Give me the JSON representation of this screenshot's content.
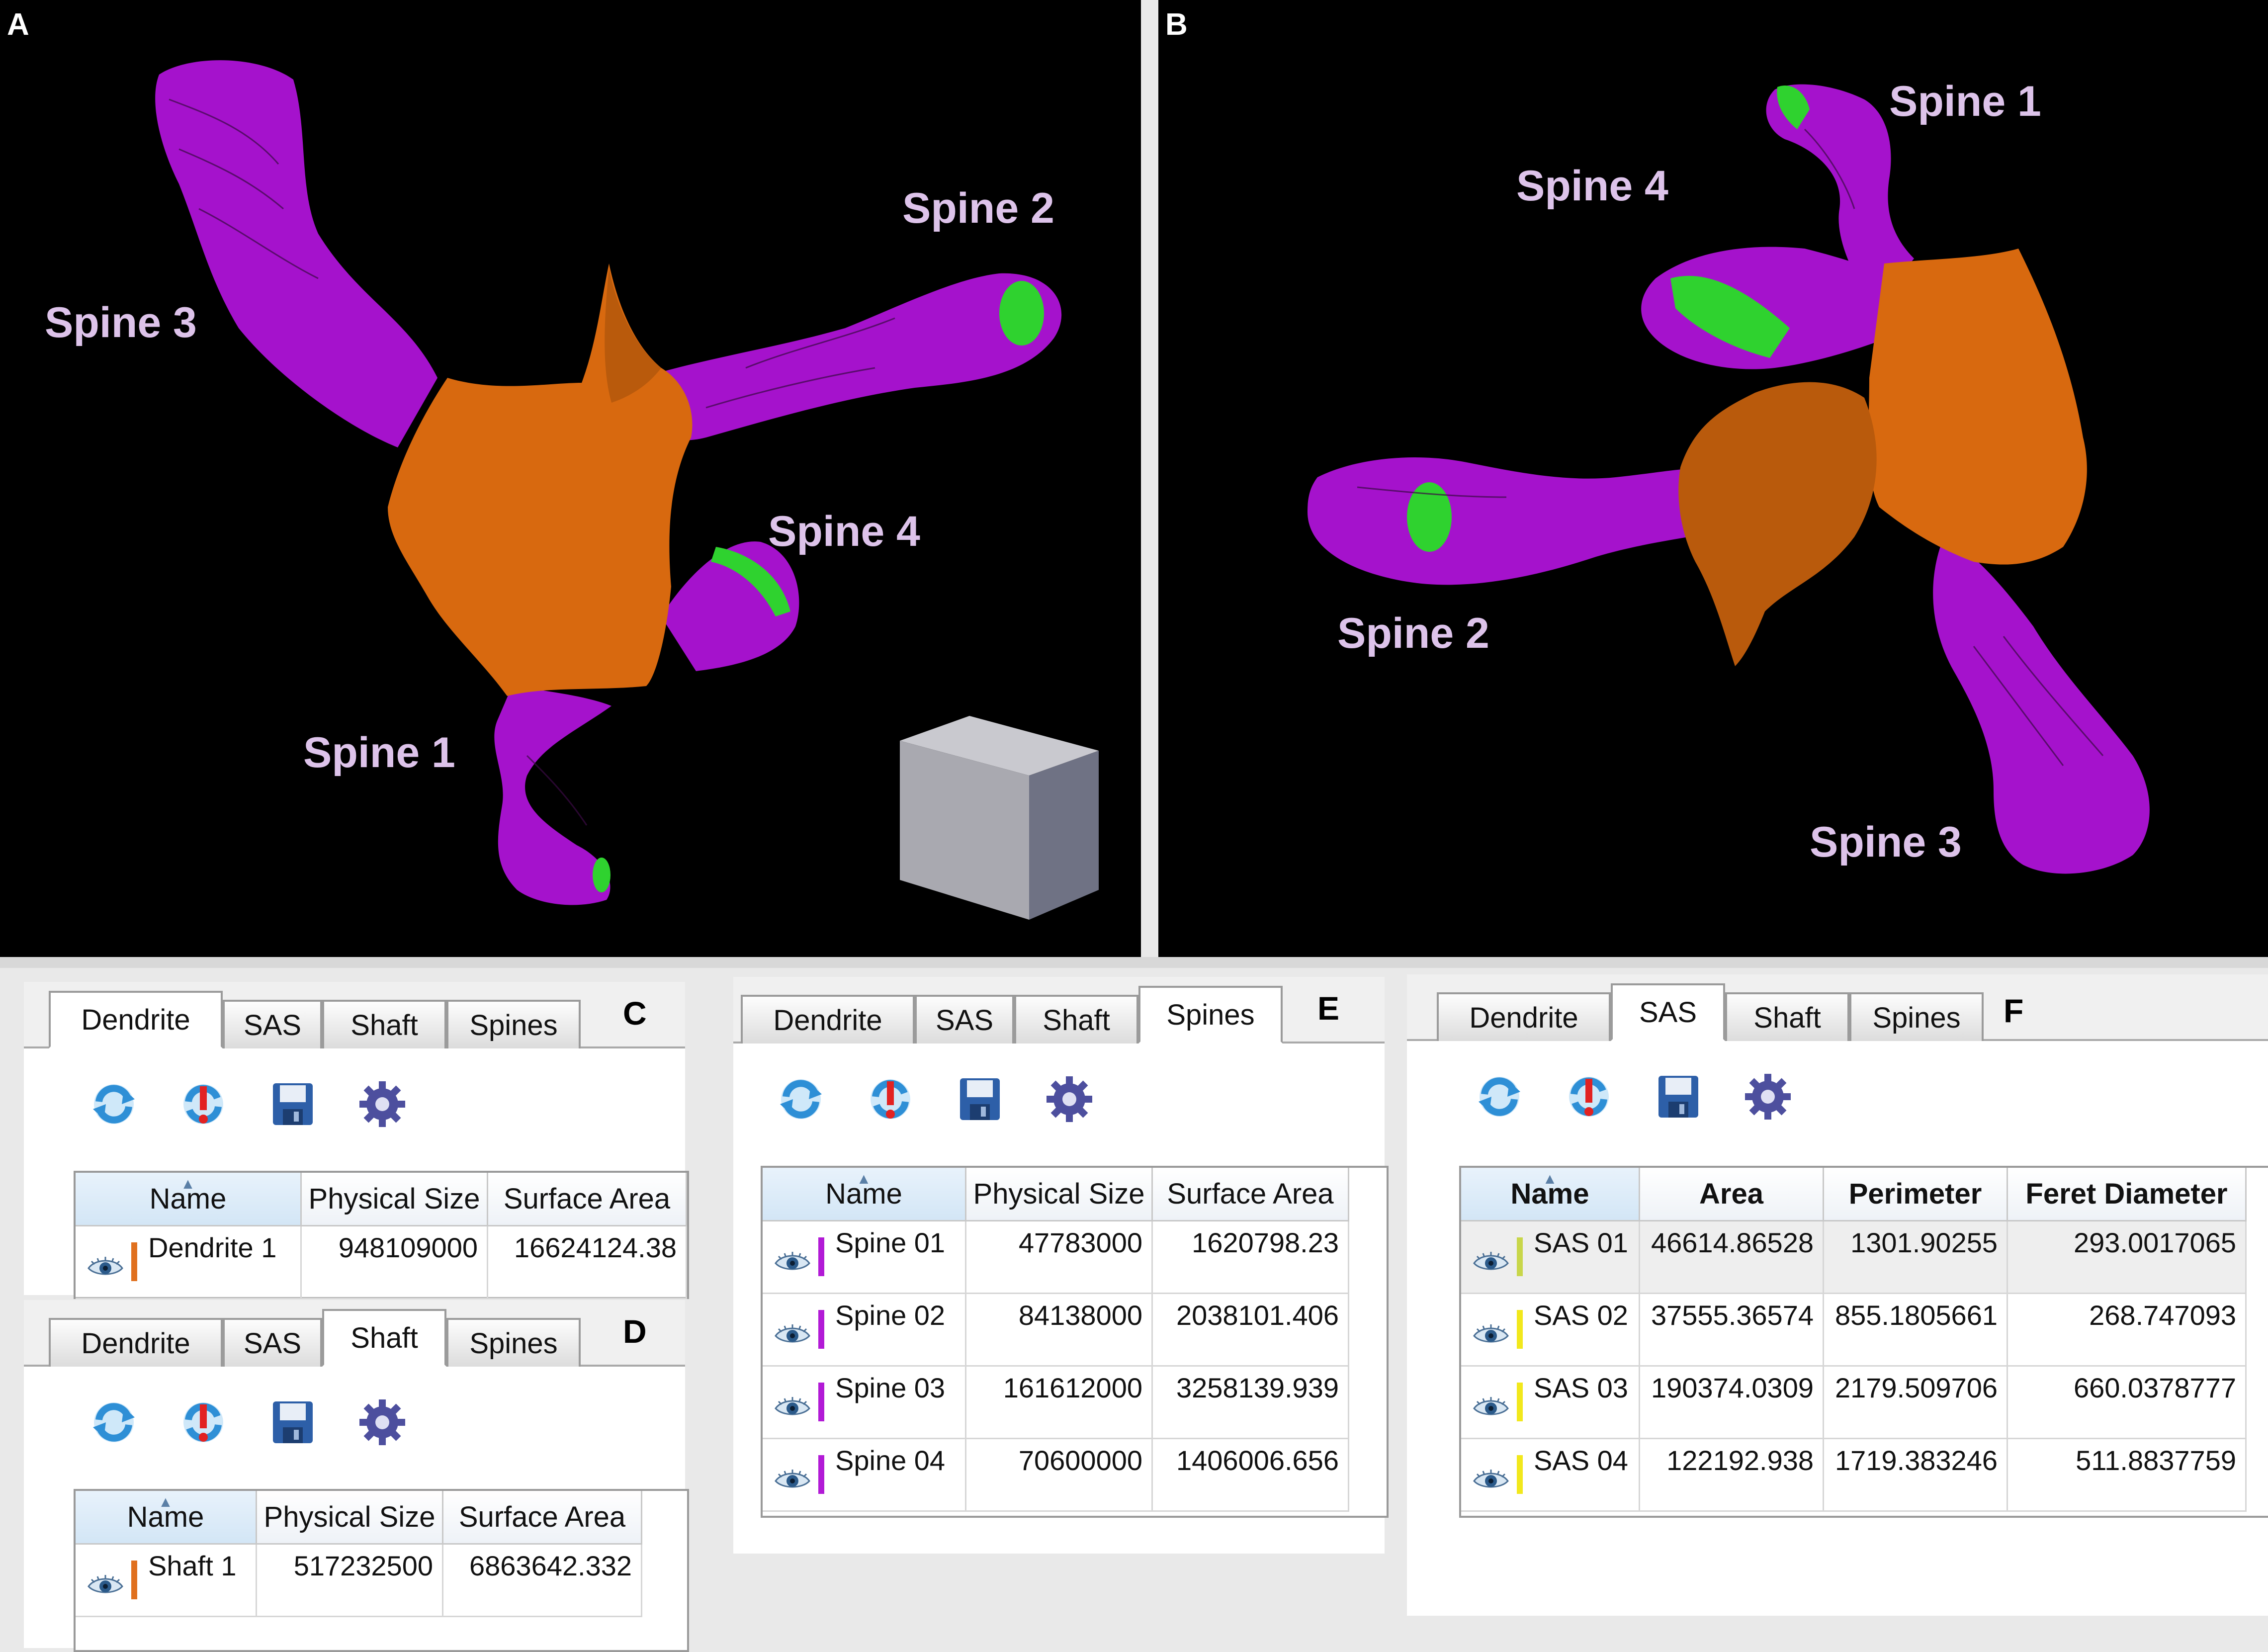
{
  "views": {
    "a": {
      "letter": "A",
      "labels": {
        "spine3": "Spine 3",
        "spine2": "Spine 2",
        "spine4": "Spine 4",
        "spine1": "Spine 1"
      }
    },
    "b": {
      "letter": "B",
      "labels": {
        "spine1": "Spine 1",
        "spine4": "Spine 4",
        "spine2": "Spine 2",
        "spine3": "Spine 3"
      }
    }
  },
  "colors": {
    "dendrite": "#d8690f",
    "spine": "#a512cc",
    "sas": "#2fd22f",
    "label": "#ddc3ea"
  },
  "tabs": [
    "Dendrite",
    "SAS",
    "Shaft",
    "Spines"
  ],
  "icons": [
    "refresh-icon",
    "refresh-error-icon",
    "save-icon",
    "settings-gear-icon"
  ],
  "panels": {
    "c": {
      "letter": "C",
      "active_tab": "Dendrite",
      "columns": [
        "Name",
        "Physical Size",
        "Surface Area"
      ],
      "rows": [
        {
          "name": "Dendrite 1",
          "physical_size": "948109000",
          "surface_area": "16624124.38",
          "color": "#e0701e"
        }
      ]
    },
    "d": {
      "letter": "D",
      "active_tab": "Shaft",
      "columns": [
        "Name",
        "Physical Size",
        "Surface Area"
      ],
      "rows": [
        {
          "name": "Shaft 1",
          "physical_size": "517232500",
          "surface_area": "6863642.332",
          "color": "#e0701e"
        }
      ]
    },
    "e": {
      "letter": "E",
      "active_tab": "Spines",
      "columns": [
        "Name",
        "Physical Size",
        "Surface Area"
      ],
      "rows": [
        {
          "name": "Spine 01",
          "physical_size": "47783000",
          "surface_area": "1620798.23",
          "color": "#b21ad6"
        },
        {
          "name": "Spine 02",
          "physical_size": "84138000",
          "surface_area": "2038101.406",
          "color": "#b21ad6"
        },
        {
          "name": "Spine 03",
          "physical_size": "161612000",
          "surface_area": "3258139.939",
          "color": "#b21ad6"
        },
        {
          "name": "Spine 04",
          "physical_size": "70600000",
          "surface_area": "1406006.656",
          "color": "#b21ad6"
        }
      ]
    },
    "f": {
      "letter": "F",
      "active_tab": "SAS",
      "columns": [
        "Name",
        "Area",
        "Perimeter",
        "Feret Diameter"
      ],
      "rows": [
        {
          "name": "SAS 01",
          "area": "46614.86528",
          "perimeter": "1301.90255",
          "feret": "293.0017065",
          "color": "#c8d64a"
        },
        {
          "name": "SAS 02",
          "area": "37555.36574",
          "perimeter": "855.1805661",
          "feret": "268.747093",
          "color": "#f2e81c"
        },
        {
          "name": "SAS 03",
          "area": "190374.0309",
          "perimeter": "2179.509706",
          "feret": "660.0378777",
          "color": "#f2e81c"
        },
        {
          "name": "SAS 04",
          "area": "122192.938",
          "perimeter": "1719.383246",
          "feret": "511.8837759",
          "color": "#f2e81c"
        }
      ]
    }
  }
}
